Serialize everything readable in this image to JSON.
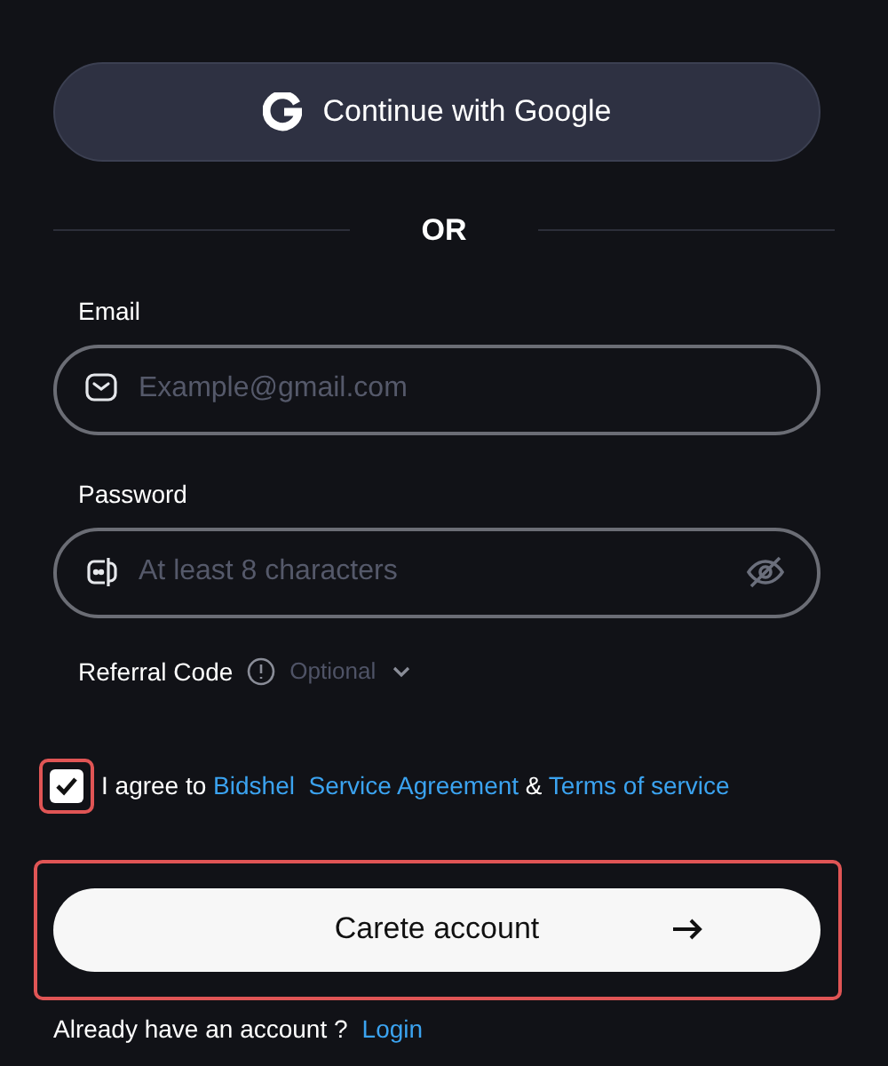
{
  "google_button": {
    "label": "Continue with Google"
  },
  "divider": {
    "label": "OR"
  },
  "fields": [
    {
      "kind": "email",
      "label": "Email",
      "placeholder": "Example@gmail.com"
    },
    {
      "kind": "password",
      "label": "Password",
      "placeholder": "At least 8 characters"
    }
  ],
  "referral": {
    "label": "Referral Code",
    "hint": "Optional",
    "expanded": false
  },
  "agreement": {
    "checked": true,
    "prefix": "I agree to",
    "link_1": "Bidshel  Service Agreement",
    "joiner": "&",
    "link_2": "Terms of service"
  },
  "submit_button": {
    "label": "Carete account"
  },
  "footer": {
    "text": "Already have an account ?",
    "link": "Login"
  }
}
